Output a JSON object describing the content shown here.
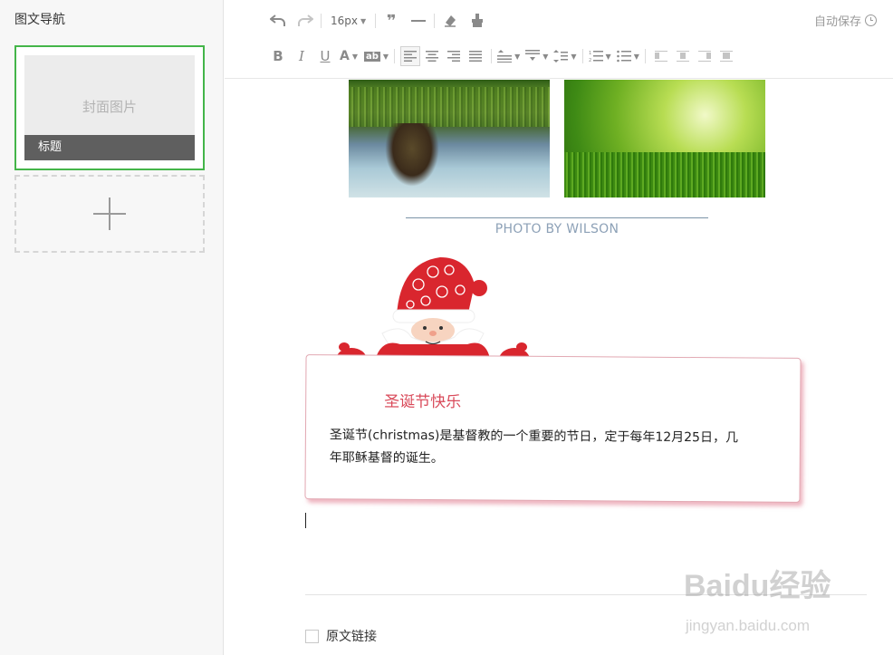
{
  "sidebar": {
    "title": "图文导航",
    "cover": {
      "placeholder": "封面图片",
      "caption": "标题"
    }
  },
  "toolbar": {
    "font_size": "16px",
    "autosave": "自动保存",
    "bold": "B",
    "italic": "I",
    "underline": "U",
    "font_color": "A",
    "bg_color": "ab"
  },
  "editor": {
    "photo_credit": "PHOTO BY WILSON",
    "card": {
      "title": "圣诞节快乐",
      "body": "圣诞节(christmas)是基督教的一个重要的节日，定于每年12月25日，几年耶稣基督的诞生。"
    },
    "source_link_label": "原文链接"
  },
  "watermark": {
    "brand": "Baidu经验",
    "url": "jingyan.baidu.com"
  },
  "colors": {
    "active_green": "#44b549",
    "card_red": "#d94a5a",
    "credit_blue": "#8da1b7"
  }
}
